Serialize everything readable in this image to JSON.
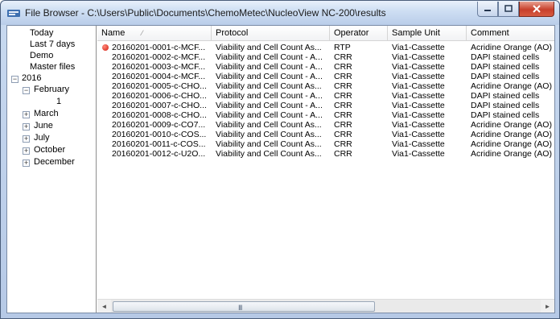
{
  "window": {
    "title": "File Browser - C:\\Users\\Public\\Documents\\ChemoMetec\\NucleoView NC-200\\results",
    "title_icon": "app-icon",
    "minimize_icon": "minimize-icon",
    "maximize_icon": "maximize-icon",
    "close_icon": "close-icon"
  },
  "tree": {
    "items": [
      {
        "label": "Today"
      },
      {
        "label": "Last 7 days"
      },
      {
        "label": "Demo"
      },
      {
        "label": "Master files"
      },
      {
        "label": "2016",
        "expander": "−"
      },
      {
        "label": "February",
        "expander": "−"
      },
      {
        "label": "1"
      },
      {
        "label": "March",
        "expander": "+"
      },
      {
        "label": "June",
        "expander": "+"
      },
      {
        "label": "July",
        "expander": "+"
      },
      {
        "label": "October",
        "expander": "+"
      },
      {
        "label": "December",
        "expander": "+"
      }
    ]
  },
  "table": {
    "columns": [
      "Name",
      "Protocol",
      "Operator",
      "Sample Unit",
      "Comment"
    ],
    "sort_indicator": "⁄",
    "rows": [
      {
        "name": "20160201-0001-c-MCF...",
        "protocol": "Viability and Cell Count As...",
        "operator": "RTP",
        "unit": "Via1-Cassette",
        "comment": "Acridine Orange (AO)",
        "marker": true
      },
      {
        "name": "20160201-0002-c-MCF...",
        "protocol": "Viability and Cell Count - A...",
        "operator": "CRR",
        "unit": "Via1-Cassette",
        "comment": "DAPI stained cells"
      },
      {
        "name": "20160201-0003-c-MCF...",
        "protocol": "Viability and Cell Count - A...",
        "operator": "CRR",
        "unit": "Via1-Cassette",
        "comment": "DAPI stained cells"
      },
      {
        "name": "20160201-0004-c-MCF...",
        "protocol": "Viability and Cell Count - A...",
        "operator": "CRR",
        "unit": "Via1-Cassette",
        "comment": "DAPI stained cells"
      },
      {
        "name": "20160201-0005-c-CHO...",
        "protocol": "Viability and Cell Count As...",
        "operator": "CRR",
        "unit": "Via1-Cassette",
        "comment": "Acridine Orange (AO)"
      },
      {
        "name": "20160201-0006-c-CHO...",
        "protocol": "Viability and Cell Count - A...",
        "operator": "CRR",
        "unit": "Via1-Cassette",
        "comment": "DAPI stained cells"
      },
      {
        "name": "20160201-0007-c-CHO...",
        "protocol": "Viability and Cell Count - A...",
        "operator": "CRR",
        "unit": "Via1-Cassette",
        "comment": "DAPI stained cells"
      },
      {
        "name": "20160201-0008-c-CHO...",
        "protocol": "Viability and Cell Count - A...",
        "operator": "CRR",
        "unit": "Via1-Cassette",
        "comment": "DAPI stained cells"
      },
      {
        "name": "20160201-0009-c-CO7...",
        "protocol": "Viability and Cell Count As...",
        "operator": "CRR",
        "unit": "Via1-Cassette",
        "comment": "Acridine Orange (AO)"
      },
      {
        "name": "20160201-0010-c-COS...",
        "protocol": "Viability and Cell Count As...",
        "operator": "CRR",
        "unit": "Via1-Cassette",
        "comment": "Acridine Orange (AO)"
      },
      {
        "name": "20160201-0011-c-COS...",
        "protocol": "Viability and Cell Count As...",
        "operator": "CRR",
        "unit": "Via1-Cassette",
        "comment": "Acridine Orange (AO)"
      },
      {
        "name": "20160201-0012-c-U2O...",
        "protocol": "Viability and Cell Count As...",
        "operator": "CRR",
        "unit": "Via1-Cassette",
        "comment": "Acridine Orange (AO)"
      }
    ]
  },
  "scrollbar": {
    "left_arrow": "◄",
    "right_arrow": "►",
    "grip": "III"
  },
  "colors": {
    "marker": "#d31a10",
    "close_button": "#c7402c"
  }
}
